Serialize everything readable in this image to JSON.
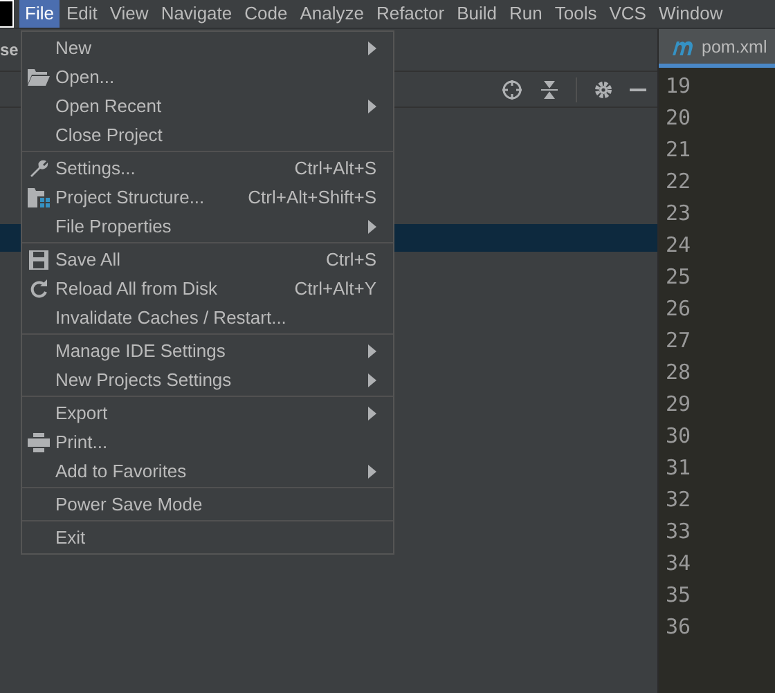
{
  "menubar": {
    "items": [
      {
        "label": "File",
        "selected": true
      },
      {
        "label": "Edit",
        "selected": false
      },
      {
        "label": "View",
        "selected": false
      },
      {
        "label": "Navigate",
        "selected": false
      },
      {
        "label": "Code",
        "selected": false
      },
      {
        "label": "Analyze",
        "selected": false
      },
      {
        "label": "Refactor",
        "selected": false
      },
      {
        "label": "Build",
        "selected": false
      },
      {
        "label": "Run",
        "selected": false
      },
      {
        "label": "Tools",
        "selected": false
      },
      {
        "label": "VCS",
        "selected": false
      },
      {
        "label": "Window",
        "selected": false
      }
    ]
  },
  "breadcrumb": "se",
  "editor": {
    "tab": "pom.xml",
    "line_numbers": [
      "19",
      "20",
      "21",
      "22",
      "23",
      "24",
      "25",
      "26",
      "27",
      "28",
      "29",
      "30",
      "31",
      "32",
      "33",
      "34",
      "35",
      "36"
    ]
  },
  "file_menu": {
    "groups": [
      [
        {
          "label": "New",
          "submenu": true
        },
        {
          "label": "Open...",
          "kind": "open"
        },
        {
          "label": "Open Recent",
          "submenu": true
        },
        {
          "label": "Close Project"
        }
      ],
      [
        {
          "label": "Settings...",
          "shortcut": "Ctrl+Alt+S",
          "kind": "settings"
        },
        {
          "label": "Project Structure...",
          "shortcut": "Ctrl+Alt+Shift+S",
          "kind": "structure"
        },
        {
          "label": "File Properties",
          "submenu": true
        }
      ],
      [
        {
          "label": "Save All",
          "shortcut": "Ctrl+S",
          "kind": "save"
        },
        {
          "label": "Reload All from Disk",
          "shortcut": "Ctrl+Alt+Y",
          "kind": "reload"
        },
        {
          "label": "Invalidate Caches / Restart..."
        }
      ],
      [
        {
          "label": "Manage IDE Settings",
          "submenu": true
        },
        {
          "label": "New Projects Settings",
          "submenu": true
        }
      ],
      [
        {
          "label": "Export",
          "submenu": true
        },
        {
          "label": "Print...",
          "kind": "print"
        },
        {
          "label": "Add to Favorites",
          "submenu": true
        }
      ],
      [
        {
          "label": "Power Save Mode"
        }
      ],
      [
        {
          "label": "Exit"
        }
      ]
    ]
  }
}
